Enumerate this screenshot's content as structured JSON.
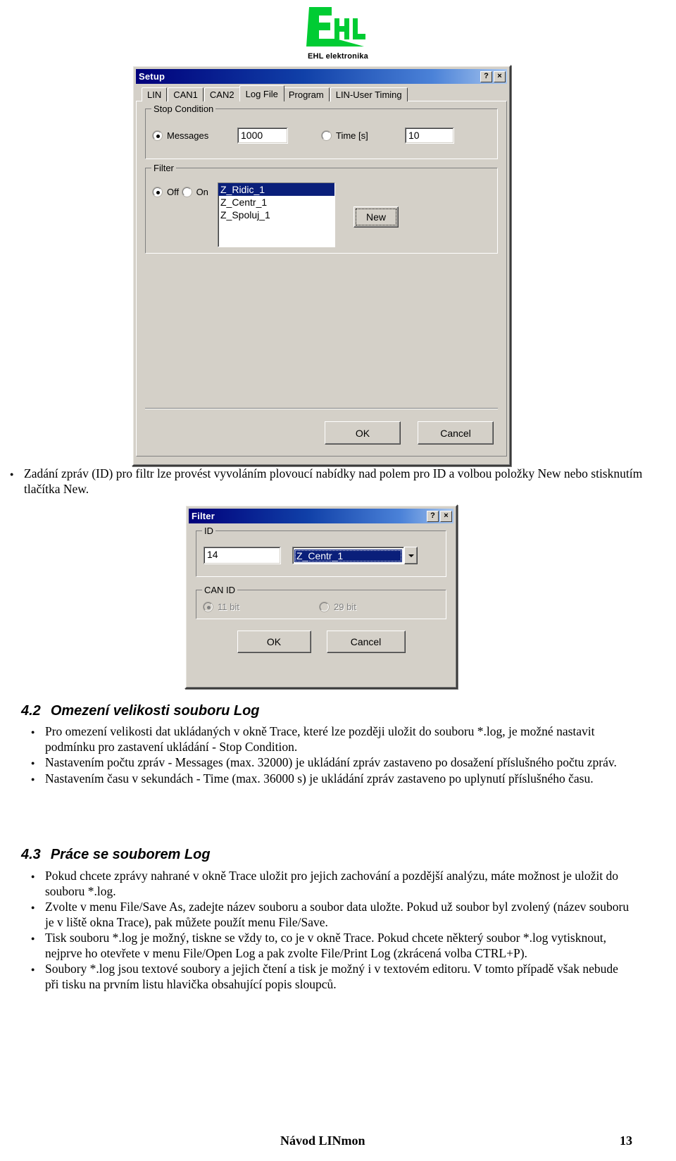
{
  "logo": {
    "mark_letters": "EHL",
    "caption": "EHL elektronika",
    "color": "#00cc33"
  },
  "setup_dialog": {
    "title": "Setup",
    "help_button": "?",
    "close_button": "×",
    "tabs": [
      {
        "label": "LIN",
        "active": false
      },
      {
        "label": "CAN1",
        "active": false
      },
      {
        "label": "CAN2",
        "active": false
      },
      {
        "label": "Log File",
        "active": true
      },
      {
        "label": "Program",
        "active": false
      },
      {
        "label": "LIN-User Timing",
        "active": false
      }
    ],
    "stop_condition": {
      "title": "Stop Condition",
      "messages_label": "Messages",
      "messages_value": "1000",
      "time_label": "Time [s]",
      "time_value": "10"
    },
    "filter_group": {
      "title": "Filter",
      "off_label": "Off",
      "on_label": "On",
      "items": [
        "Z_Ridic_1",
        "Z_Centr_1",
        "Z_Spoluj_1"
      ],
      "selected_item": "Z_Ridic_1",
      "new_button": "New"
    },
    "ok_button": "OK",
    "cancel_button": "Cancel"
  },
  "filter_dialog": {
    "title": "Filter",
    "help_button": "?",
    "close_button": "×",
    "id_group": {
      "title": "ID",
      "id_value": "14",
      "name_value": "Z_Centr_1"
    },
    "can_id_group": {
      "title": "CAN ID",
      "bit11_label": "11 bit",
      "bit29_label": "29 bit"
    },
    "ok_button": "OK",
    "cancel_button": "Cancel"
  },
  "body": {
    "bullet_after_setup": "Zadání zpráv (ID) pro filtr lze provést vyvoláním plovoucí nabídky nad polem pro ID a volbou položky New nebo stisknutím tlačítka New.",
    "section_42": {
      "number": "4.2",
      "title": "Omezení velikosti souboru Log",
      "bullets": [
        "Pro omezení velikosti dat ukládaných v okně Trace, které lze později uložit do souboru *.log, je možné nastavit podmínku pro zastavení ukládání - Stop Condition.",
        "Nastavením počtu zpráv - Messages (max. 32000) je ukládání zpráv zastaveno po dosažení příslušného počtu zpráv.",
        "Nastavením času v sekundách - Time (max. 36000 s) je ukládání zpráv zastaveno po uplynutí příslušného času."
      ]
    },
    "section_43": {
      "number": "4.3",
      "title": "Práce se souborem Log",
      "bullets": [
        "Pokud chcete zprávy nahrané v okně Trace uložit pro jejich zachování a pozdější analýzu, máte možnost je uložit do souboru *.log.",
        "Zvolte v menu File/Save As, zadejte název souboru a soubor data uložte. Pokud už soubor byl zvolený (název souboru je v liště okna Trace),  pak můžete použít menu File/Save.",
        "Tisk souboru *.log je možný, tiskne se vždy to, co je v okně Trace. Pokud chcete některý soubor *.log vytisknout, nejprve ho otevřete v menu File/Open Log a pak zvolte File/Print Log (zkrácená volba CTRL+P).",
        "Soubory *.log jsou textové soubory a jejich čtení a tisk je možný i v textovém editoru. V tomto případě však nebude při tisku na prvním listu hlavička obsahující popis sloupců."
      ]
    }
  },
  "footer": {
    "doc_title": "Návod LINmon",
    "page_number": "13"
  }
}
